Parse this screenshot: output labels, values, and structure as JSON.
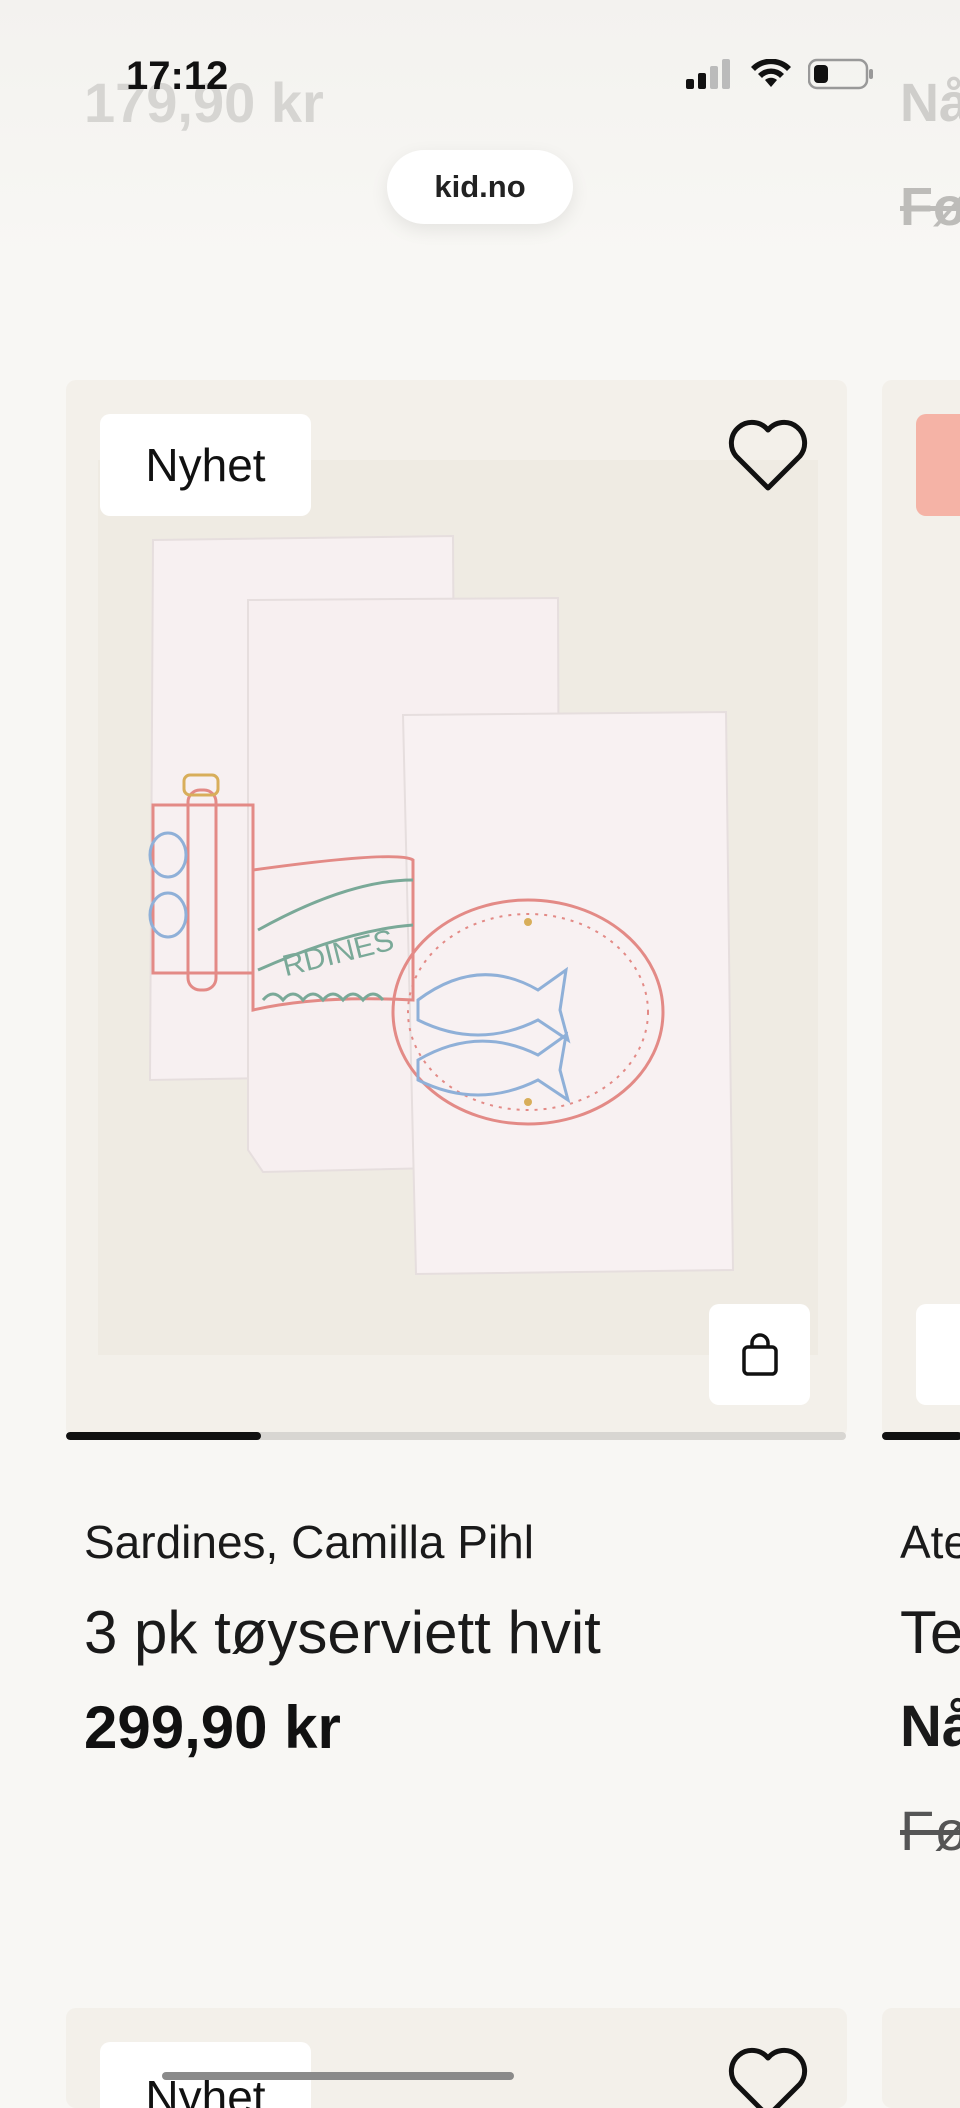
{
  "status_bar": {
    "time": "17:12"
  },
  "browser": {
    "url": "kid.no"
  },
  "faded_above": {
    "price": "179,90 kr",
    "right_top": "Nå",
    "right_strike": "Fø"
  },
  "product": {
    "badge": "Nyhet",
    "brand": "Sardines, Camilla Pihl",
    "title": "3 pk tøyserviett hvit",
    "price": "299,90 kr",
    "image_progress": 0.25
  },
  "next_product_partial": {
    "brand": "Ate",
    "title": "Te",
    "price_label": "Nå",
    "strike_label": "Fø"
  },
  "next_row_partial": {
    "badge": "Nyhet"
  },
  "colors": {
    "background": "#f8f7f4",
    "card": "#f3f0ea",
    "sale_badge": "#f5b3a6",
    "text": "#1a1a1a"
  },
  "icons": [
    "signal-icon",
    "wifi-icon",
    "battery-icon",
    "heart-icon",
    "shopping-bag-icon"
  ]
}
